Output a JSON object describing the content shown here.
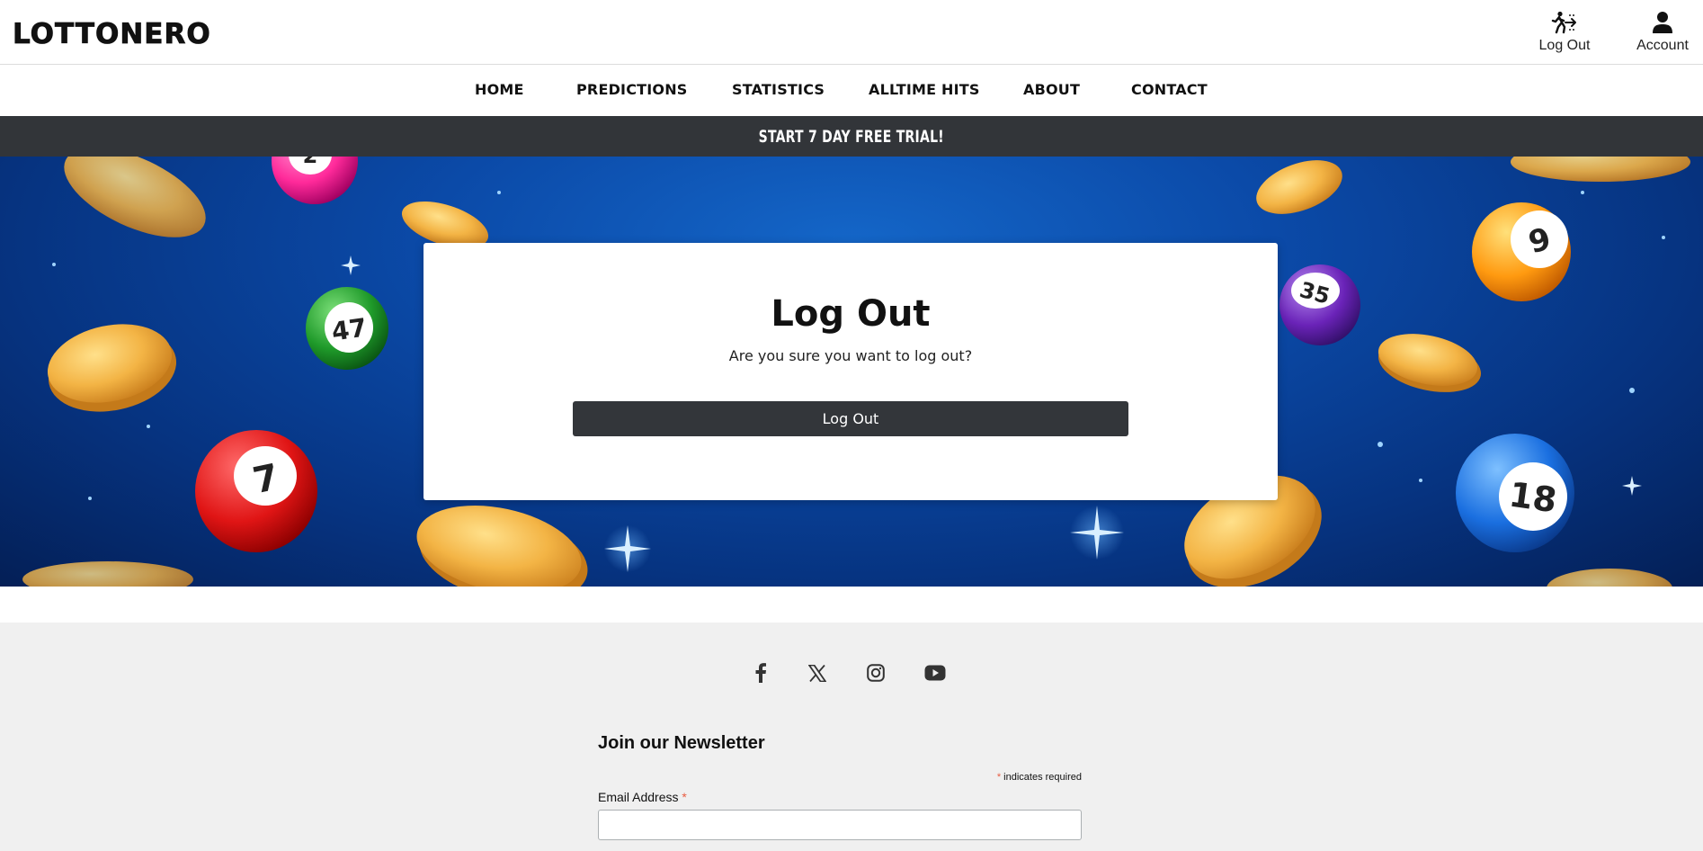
{
  "header": {
    "logo": "LOTTONERO",
    "logout_label": "Log Out",
    "account_label": "Account"
  },
  "nav": {
    "items": [
      "HOME",
      "PREDICTIONS",
      "STATISTICS",
      "ALLTIME HITS",
      "ABOUT",
      "CONTACT"
    ]
  },
  "promo": {
    "text": "START 7 DAY FREE TRIAL!"
  },
  "hero": {
    "ball_numbers": [
      "2",
      "47",
      "7",
      "35",
      "9",
      "18"
    ]
  },
  "card": {
    "title": "Log Out",
    "message": "Are you sure you want to log out?",
    "button_label": "Log Out"
  },
  "footer": {
    "social_icons": [
      "facebook-icon",
      "x-icon",
      "instagram-icon",
      "youtube-icon"
    ],
    "newsletter": {
      "title": "Join our Newsletter",
      "required_asterisk": "*",
      "required_note": "indicates required",
      "email_label": "Email Address",
      "email_value": ""
    }
  },
  "colors": {
    "promo_bg": "#323539",
    "button_bg": "#33363a",
    "footer_bg": "#f0f0f0",
    "hero_blue": "#0b4aa8",
    "required_asterisk": "#e85c41"
  }
}
